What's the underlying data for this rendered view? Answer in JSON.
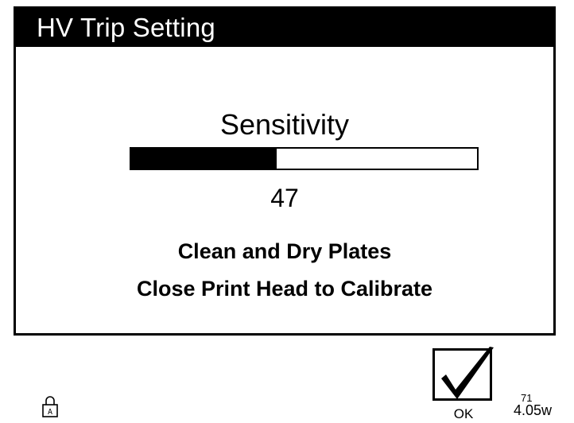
{
  "dialog": {
    "title": "HV Trip Setting",
    "sensitivity_label": "Sensitivity",
    "sensitivity_value": "47",
    "sensitivity_fraction": 0.42,
    "instruction_line1": "Clean and Dry Plates",
    "instruction_line2": "Close Print Head to Calibrate"
  },
  "ok_button": {
    "label": "OK",
    "icon": "checkmark-icon"
  },
  "status": {
    "lock_icon": "lock-icon",
    "lock_letter": "A",
    "top_value": "71",
    "bottom_value": "4.05w"
  }
}
